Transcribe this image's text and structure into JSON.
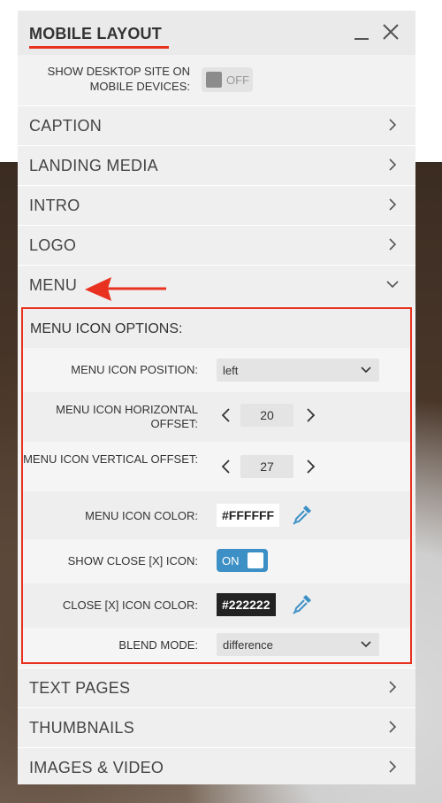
{
  "panel": {
    "title": "MOBILE LAYOUT",
    "show_desktop_label": "SHOW DESKTOP SITE ON MOBILE DEVICES:",
    "show_desktop_toggle": "OFF"
  },
  "sections_top": [
    {
      "label": "CAPTION"
    },
    {
      "label": "LANDING MEDIA"
    },
    {
      "label": "INTRO"
    },
    {
      "label": "LOGO"
    }
  ],
  "menu_section": {
    "label": "MENU",
    "options_title": "MENU ICON OPTIONS:",
    "position": {
      "label": "MENU ICON POSITION:",
      "value": "left"
    },
    "h_offset": {
      "label": "MENU ICON HORIZONTAL OFFSET:",
      "value": "20"
    },
    "v_offset": {
      "label": "MENU ICON VERTICAL OFFSET:",
      "value": "27"
    },
    "icon_color": {
      "label": "MENU ICON COLOR:",
      "value": "#FFFFFF"
    },
    "show_close": {
      "label": "SHOW CLOSE [X] ICON:",
      "value": "ON"
    },
    "close_color": {
      "label": "CLOSE [X] ICON COLOR:",
      "value": "#222222"
    },
    "blend": {
      "label": "BLEND MODE:",
      "value": "difference"
    }
  },
  "sections_bottom": [
    {
      "label": "TEXT PAGES"
    },
    {
      "label": "THUMBNAILS"
    },
    {
      "label": "IMAGES & VIDEO"
    }
  ],
  "colors": {
    "accent": "#e8321f",
    "toggle_on": "#3d90c5",
    "dropper": "#3d90c5"
  }
}
